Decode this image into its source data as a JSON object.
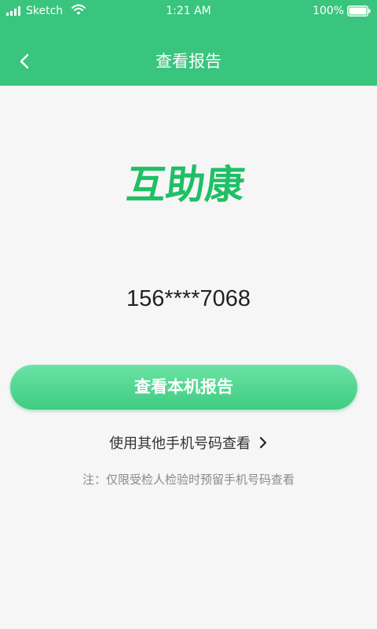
{
  "status_bar": {
    "carrier": "Sketch",
    "time": "1:21 AM",
    "battery": "100%",
    "icons": [
      "signal-icon",
      "wifi-icon",
      "battery-icon"
    ]
  },
  "nav": {
    "back_icon": "chevron-left-icon",
    "title": "查看报告"
  },
  "logo": {
    "text": "互助康"
  },
  "phone": {
    "masked_number": "156****7068"
  },
  "actions": {
    "primary_label": "查看本机报告",
    "other_label": "使用其他手机号码查看",
    "other_icon": "chevron-right-icon"
  },
  "note": "注：仅限受检人检验时预留手机号码查看",
  "colors": {
    "brand": "#3ac57e",
    "button_gradient_top": "#6be3a4",
    "button_gradient_bottom": "#3fcb82",
    "logo_green": "#1fbf66",
    "background": "#f6f6f6"
  }
}
